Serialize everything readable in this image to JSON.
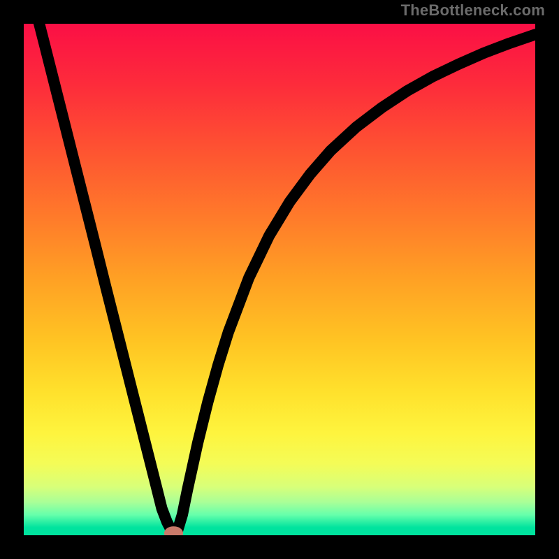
{
  "watermark": "TheBottleneck.com",
  "chart_data": {
    "type": "line",
    "title": "",
    "xlabel": "",
    "ylabel": "",
    "xlim": [
      0,
      100
    ],
    "ylim": [
      0,
      100
    ],
    "background_gradient_stops": [
      {
        "offset": 0.0,
        "color": "#fb0f45"
      },
      {
        "offset": 0.12,
        "color": "#fd2c3b"
      },
      {
        "offset": 0.25,
        "color": "#fe5431"
      },
      {
        "offset": 0.38,
        "color": "#ff7b2a"
      },
      {
        "offset": 0.5,
        "color": "#ffa124"
      },
      {
        "offset": 0.62,
        "color": "#ffc423"
      },
      {
        "offset": 0.72,
        "color": "#ffe12c"
      },
      {
        "offset": 0.8,
        "color": "#fef43e"
      },
      {
        "offset": 0.86,
        "color": "#f4fc57"
      },
      {
        "offset": 0.905,
        "color": "#d8ff79"
      },
      {
        "offset": 0.935,
        "color": "#aaff97"
      },
      {
        "offset": 0.96,
        "color": "#66ffab"
      },
      {
        "offset": 0.985,
        "color": "#00e39e"
      },
      {
        "offset": 1.0,
        "color": "#00e39e"
      }
    ],
    "series": [
      {
        "name": "bottleneck-curve",
        "x": [
          0,
          2,
          4,
          6,
          8,
          10,
          12,
          14,
          16,
          18,
          20,
          22,
          24,
          26,
          27,
          28,
          29,
          30,
          31,
          32,
          34,
          36,
          38,
          40,
          44,
          48,
          52,
          56,
          60,
          65,
          70,
          75,
          80,
          85,
          90,
          95,
          100
        ],
        "y": [
          112,
          104,
          96.2,
          88.3,
          80.4,
          72.5,
          64.6,
          56.7,
          48.7,
          40.8,
          32.9,
          25.0,
          17.1,
          9.2,
          5.2,
          2.6,
          0.7,
          0.7,
          4.0,
          8.9,
          18.0,
          26.1,
          33.3,
          39.7,
          50.3,
          58.6,
          65.2,
          70.6,
          75.2,
          79.8,
          83.6,
          86.9,
          89.7,
          92.1,
          94.3,
          96.2,
          97.9
        ]
      }
    ],
    "marker": {
      "x": 29.3,
      "y": 0.4,
      "rx": 1.6,
      "ry": 1.1
    }
  }
}
